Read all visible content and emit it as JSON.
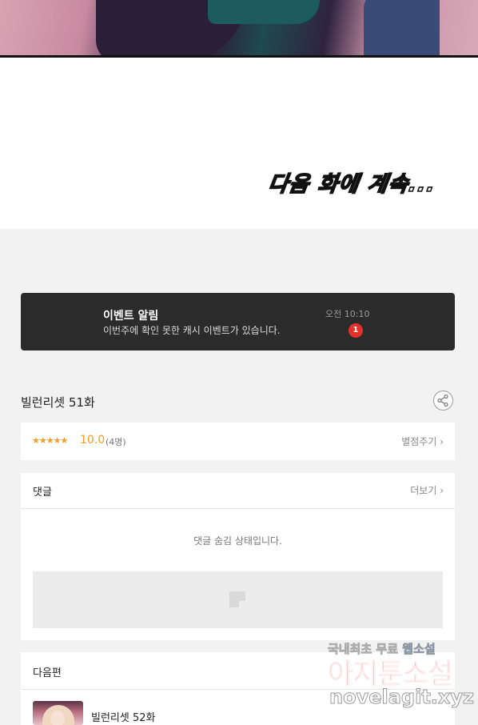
{
  "continue_text": "다음 화에 계속...",
  "event": {
    "title": "이벤트 알림",
    "description": "이번주에 확인 못한 캐시 이벤트가 있습니다.",
    "time": "오전 10:10",
    "badge_count": "1"
  },
  "episode": {
    "title": "빌런리셋 51화",
    "share_icon": "share-icon"
  },
  "rating": {
    "stars": "★★★★★",
    "score": "10.0",
    "count": "(4명)",
    "rate_button": "별점주기 ›"
  },
  "comments": {
    "header": "댓글",
    "more": "더보기 ›",
    "hidden_message": "댓글 숨김 상태입니다."
  },
  "next_episode": {
    "header": "다음편",
    "title": "빌런리셋 52화"
  },
  "watermark": {
    "line1": "국내최초 무료",
    "line1_highlight": "웹소설",
    "line2": "아지툰소설",
    "line3": "novelagit.xyz"
  },
  "colors": {
    "accent": "#f49b23",
    "badge": "#e4322b",
    "event_bg": "#2b2b2b"
  }
}
